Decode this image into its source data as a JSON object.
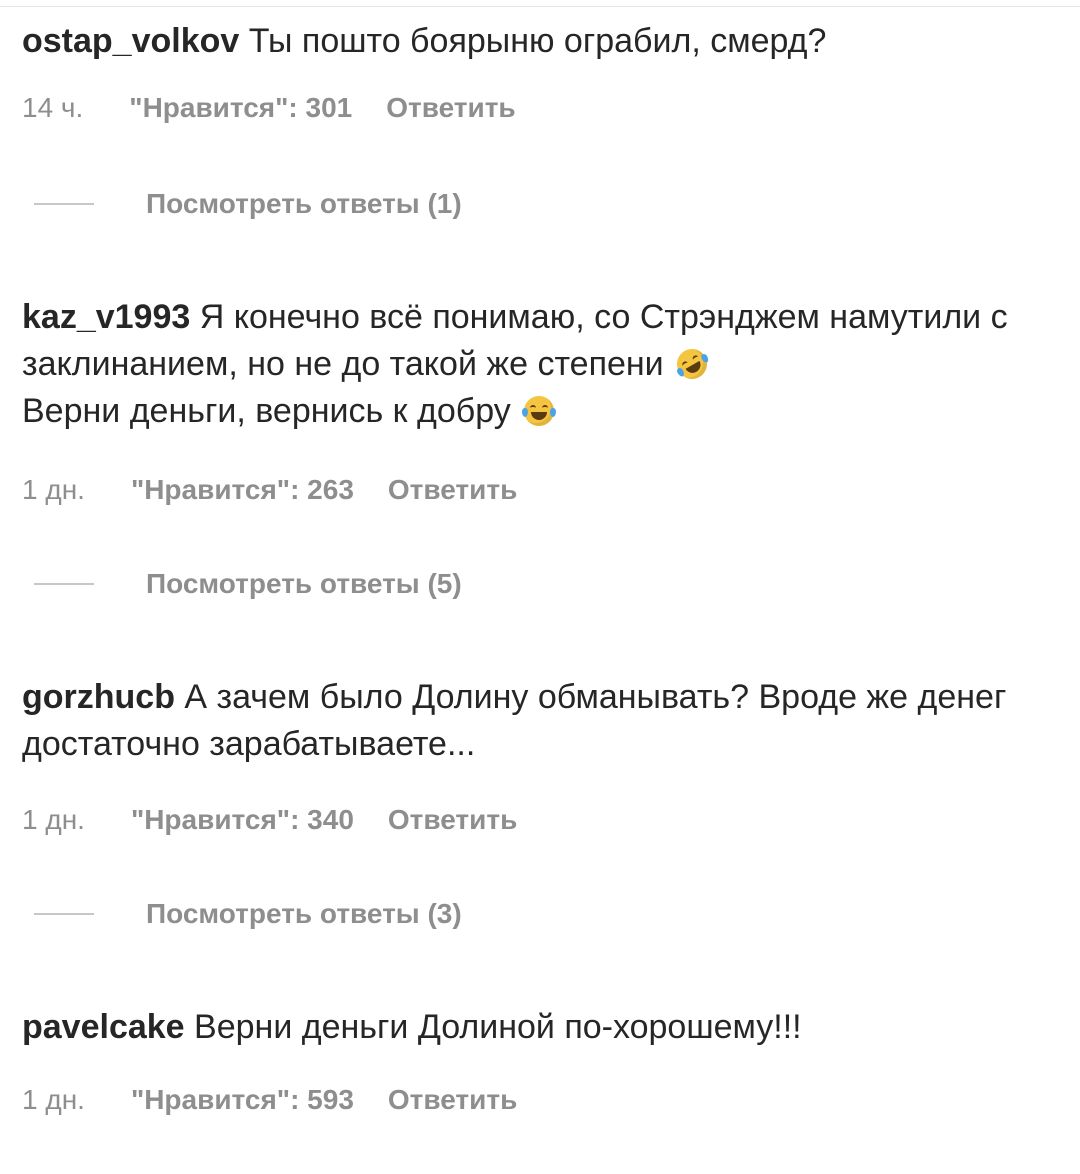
{
  "comments": [
    {
      "username": "ostap_volkov",
      "text": " Ты пошто боярыню ограбил, смерд?",
      "time": "14 ч.",
      "likes": "\"Нравится\": 301",
      "reply": "Ответить",
      "view_replies": "Посмотреть ответы (1)"
    },
    {
      "username": "kaz_v1993",
      "text_line1": " Я конечно всё понимаю, со Стрэнджем намутили с заклинанием, но не до такой же степени ",
      "emoji1": "rolling-on-floor-laughing-emoji-icon",
      "text_line2": "Верни деньги, вернись к добру ",
      "emoji2": "tears-of-joy-emoji-icon",
      "time": "1 дн.",
      "likes": "\"Нравится\": 263",
      "reply": "Ответить",
      "view_replies": "Посмотреть ответы (5)"
    },
    {
      "username": "gorzhucb",
      "text": " А зачем было Долину обманывать? Вроде же денег достаточно зарабатываете...",
      "time": "1 дн.",
      "likes": "\"Нравится\": 340",
      "reply": "Ответить",
      "view_replies": "Посмотреть ответы (3)"
    },
    {
      "username": "pavelcake",
      "text": " Верни деньги Долиной по-хорошему!!!",
      "time": "1 дн.",
      "likes": "\"Нравится\": 593",
      "reply": "Ответить"
    }
  ],
  "colors": {
    "text": "#262626",
    "secondary": "#8e8e8e",
    "divider": "#c7c7c7",
    "background": "#ffffff"
  }
}
